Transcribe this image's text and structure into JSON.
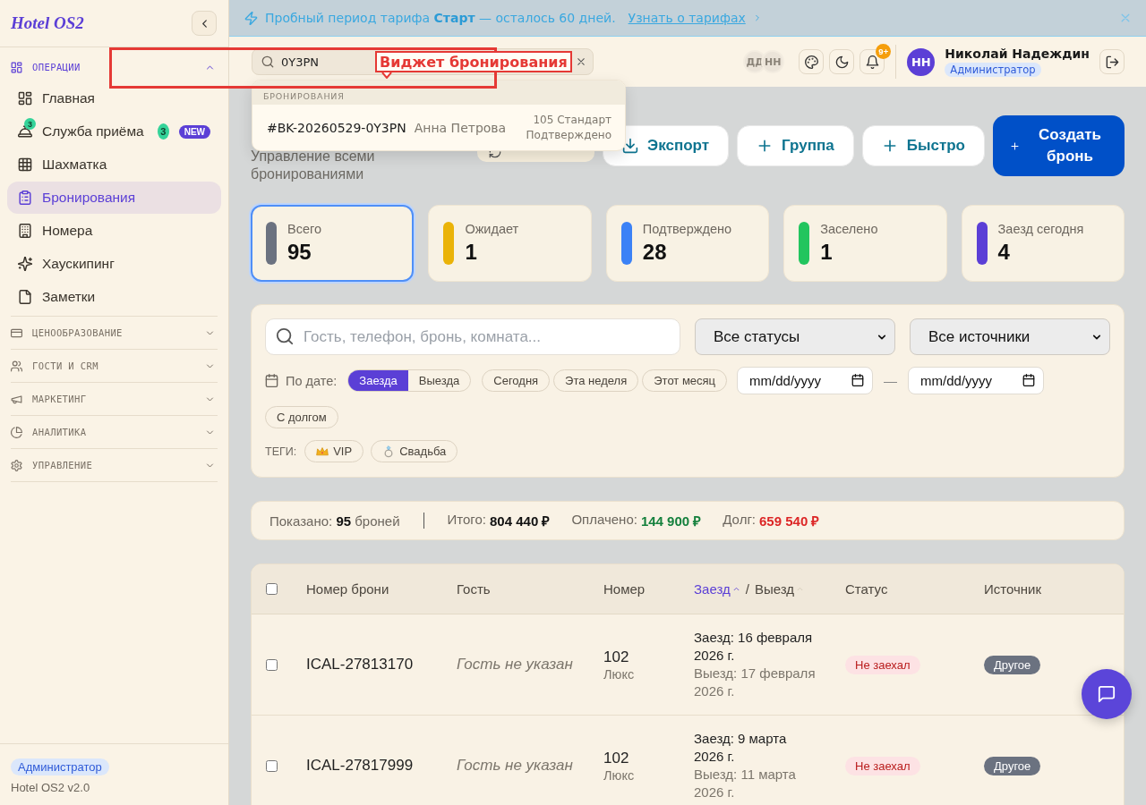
{
  "sidebar": {
    "logo": "Hotel OS2",
    "groups": [
      {
        "label": "ОПЕРАЦИИ",
        "expanded": true,
        "items": [
          {
            "label": "Главная",
            "selected": false
          },
          {
            "label": "Служба приёма",
            "selected": false,
            "icon_badge": "3",
            "count": "3",
            "tag": "NEW"
          },
          {
            "label": "Шахматка",
            "selected": false
          },
          {
            "label": "Бронирования",
            "selected": true
          },
          {
            "label": "Номера",
            "selected": false
          },
          {
            "label": "Хаускипинг",
            "selected": false
          },
          {
            "label": "Заметки",
            "selected": false
          }
        ]
      },
      {
        "label": "ЦЕНООБРАЗОВАНИЕ",
        "expanded": false
      },
      {
        "label": "ГОСТИ И CRM",
        "expanded": false
      },
      {
        "label": "МАРКЕТИНГ",
        "expanded": false
      },
      {
        "label": "АНАЛИТИКА",
        "expanded": false
      },
      {
        "label": "УПРАВЛЕНИЕ",
        "expanded": false
      }
    ],
    "footer": {
      "role": "Администратор",
      "version": "Hotel OS2 v2.0"
    }
  },
  "banner": {
    "text": "Пробный период тарифа **Старт** — осталось 60 дней.",
    "link": "Узнать о тарифах"
  },
  "header": {
    "search": {
      "value": "0Y3PN"
    },
    "presence": [
      "ДД",
      "НН"
    ],
    "notifications": {
      "badge": "9+"
    },
    "user": {
      "initials": "НН",
      "name": "Николай Надеждин",
      "role": "Администратор"
    }
  },
  "search_results": {
    "section": "БРОНИРОВАНИЯ",
    "items": [
      {
        "code": "#BK-20260529-0Y3PN",
        "guest": "Анна Петрова",
        "room": "105 Стандарт",
        "status": "Подтверждено"
      }
    ]
  },
  "annotation": {
    "label": "Виджет бронирования"
  },
  "page": {
    "subtitle": "Управление всеми бронированиями",
    "actions": [
      {
        "kind": "covered"
      },
      {
        "kind": "secondary",
        "label": "Экспорт"
      },
      {
        "kind": "secondary",
        "label": "Группа"
      },
      {
        "kind": "secondary",
        "label": "Быстро"
      },
      {
        "kind": "primary",
        "label": "Создать бронь"
      }
    ]
  },
  "stats": [
    {
      "label": "Всего",
      "value": "95",
      "color": "#6b7280",
      "selected": true
    },
    {
      "label": "Ожидает",
      "value": "1",
      "color": "#eab308",
      "selected": false
    },
    {
      "label": "Подтверждено",
      "value": "28",
      "color": "#3b82f6",
      "selected": false
    },
    {
      "label": "Заселено",
      "value": "1",
      "color": "#22c55e",
      "selected": false
    },
    {
      "label": "Заезд сегодня",
      "value": "4",
      "color": "#5b3fd6",
      "selected": false
    }
  ],
  "filters": {
    "search": {
      "placeholder": "Гость, телефон, бронь, комната..."
    },
    "selects": [
      {
        "value": "Все статусы"
      },
      {
        "value": "Все источники"
      }
    ],
    "date": {
      "label": "По дате:",
      "modes": [
        {
          "label": "Заезда",
          "selected": true
        },
        {
          "label": "Выезда",
          "selected": false
        }
      ],
      "presets": [
        {
          "label": "Сегодня",
          "selected": false
        },
        {
          "label": "Эта неделя",
          "selected": false
        },
        {
          "label": "Этот месяц",
          "selected": false
        }
      ],
      "from": {
        "placeholder": "mm/dd/yyyy"
      },
      "separator": "—",
      "to": {
        "placeholder": "mm/dd/yyyy"
      }
    },
    "debt": {
      "label": "С долгом",
      "selected": false
    },
    "tags": {
      "label": "ТЕГИ:",
      "items": [
        {
          "label": "VIP",
          "selected": false
        },
        {
          "label": "Свадьба",
          "selected": false
        }
      ]
    }
  },
  "summary": {
    "shown": "Показано: **95** броней",
    "totals": [
      {
        "kind": "total",
        "label": "Итого:",
        "value": "804 440 ₽"
      },
      {
        "kind": "paid",
        "label": "Оплачено:",
        "value": "144 900 ₽"
      },
      {
        "kind": "debt",
        "label": "Долг:",
        "value": "659 540 ₽"
      }
    ]
  },
  "table": {
    "select_all": {
      "checked": false
    },
    "columns": [
      {
        "kind": "text",
        "label": "Номер брони"
      },
      {
        "kind": "text",
        "label": "Гость"
      },
      {
        "kind": "text",
        "label": "Номер"
      },
      {
        "kind": "sort",
        "separator": "/",
        "items": [
          {
            "label": "Заезд",
            "selected": true
          },
          {
            "label": "Выезд",
            "selected": false
          }
        ]
      },
      {
        "kind": "text",
        "label": "Статус"
      },
      {
        "kind": "text",
        "label": "Источник"
      }
    ],
    "rows": [
      {
        "checked": false,
        "code": "ICAL-27813170",
        "guest": "Гость не указан",
        "guest_missing": true,
        "room": "102",
        "room_type": "Люкс",
        "check_in": "Заезд: 16 февраля 2026 г.",
        "check_out": "Выезд: 17 февраля 2026 г.",
        "status": {
          "kind": "not_arrived",
          "label": "Не заехал"
        },
        "source": {
          "kind": "other",
          "label": "Другое"
        }
      },
      {
        "checked": false,
        "code": "ICAL-27817999",
        "guest": "Гость не указан",
        "guest_missing": true,
        "room": "102",
        "room_type": "Люкс",
        "check_in": "Заезд: 9 марта 2026 г.",
        "check_out": "Выезд: 11 марта 2026 г.",
        "status": {
          "kind": "not_arrived",
          "label": "Не заехал"
        },
        "source": {
          "kind": "other",
          "label": "Другое"
        }
      }
    ]
  }
}
